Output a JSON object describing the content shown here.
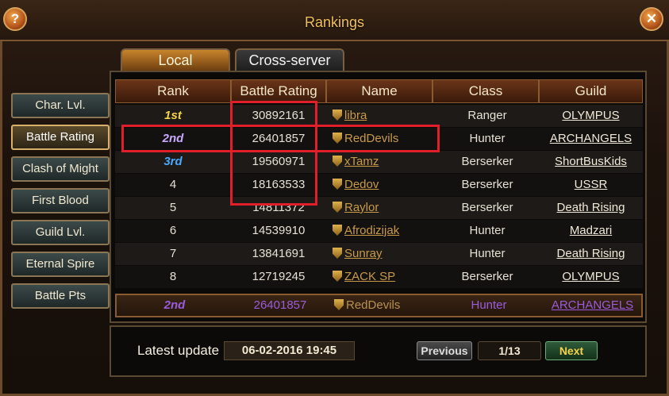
{
  "window": {
    "title": "Rankings",
    "help_label": "?",
    "close_label": "✕"
  },
  "tabs": [
    {
      "label": "Local",
      "active": true
    },
    {
      "label": "Cross-server",
      "active": false
    }
  ],
  "sidebar": {
    "items": [
      {
        "label": "Char. Lvl.",
        "active": false
      },
      {
        "label": "Battle Rating",
        "active": true
      },
      {
        "label": "Clash of Might",
        "active": false
      },
      {
        "label": "First Blood",
        "active": false
      },
      {
        "label": "Guild Lvl.",
        "active": false
      },
      {
        "label": "Eternal Spire",
        "active": false
      },
      {
        "label": "Battle Pts",
        "active": false
      }
    ]
  },
  "table": {
    "columns": [
      "Rank",
      "Battle Rating",
      "Name",
      "Class",
      "Guild"
    ],
    "rows": [
      {
        "rank": "1st",
        "battle_rating": "30892161",
        "name": "libra",
        "class": "Ranger",
        "guild": "OLYMPUS"
      },
      {
        "rank": "2nd",
        "battle_rating": "26401857",
        "name": "RedDevils",
        "class": "Hunter",
        "guild": "ARCHANGELS"
      },
      {
        "rank": "3rd",
        "battle_rating": "19560971",
        "name": "xTamz",
        "class": "Berserker",
        "guild": "ShortBusKids"
      },
      {
        "rank": "4",
        "battle_rating": "18163533",
        "name": "Dedov",
        "class": "Berserker",
        "guild": "USSR"
      },
      {
        "rank": "5",
        "battle_rating": "14811372",
        "name": "Raylor",
        "class": "Berserker",
        "guild": "Death Rising"
      },
      {
        "rank": "6",
        "battle_rating": "14539910",
        "name": "Afrodizijak",
        "class": "Hunter",
        "guild": "Madzari"
      },
      {
        "rank": "7",
        "battle_rating": "13841691",
        "name": "Sunray",
        "class": "Hunter",
        "guild": "Death Rising"
      },
      {
        "rank": "8",
        "battle_rating": "12719245",
        "name": "ZACK SP",
        "class": "Berserker",
        "guild": "OLYMPUS"
      }
    ]
  },
  "self_row": {
    "rank": "2nd",
    "battle_rating": "26401857",
    "name": "RedDevils",
    "class": "Hunter",
    "guild": "ARCHANGELS"
  },
  "footer": {
    "latest_update_label": "Latest update",
    "latest_update_value": "06-02-2016 19:45",
    "previous_label": "Previous",
    "page_indicator": "1/13",
    "next_label": "Next"
  },
  "colors": {
    "highlight_box": "#e01f2a",
    "rank1": "#f5d34a",
    "rank2": "#c9a8ff",
    "rank3": "#4aa8ff",
    "self_row_text": "#9b5bdc"
  }
}
